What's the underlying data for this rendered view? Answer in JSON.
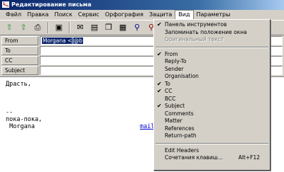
{
  "window": {
    "title": "Редактирование письма"
  },
  "menu": [
    "Файл",
    "Правка",
    "Поиск",
    "Сервис",
    "Орфография",
    "Защита",
    "Вид",
    "Параметры"
  ],
  "toolbar": {
    "icons": [
      "send-icon",
      "send-later-icon",
      "print-icon",
      "save-icon",
      "attach-icon",
      "address-book-icon",
      "copy-icon",
      "paste-icon",
      "find-icon",
      "find-next-icon",
      "spell-icon"
    ]
  },
  "headers": [
    {
      "label": "From",
      "value_prefix": "Morgana <",
      "value_hidden": "                ",
      "value_at": "@b",
      "value_suffix": "                  "
    },
    {
      "label": "To",
      "value": ""
    },
    {
      "label": "CC",
      "value": ""
    },
    {
      "label": "Subject",
      "value": ""
    }
  ],
  "body": {
    "lines": [
      "Драсть,",
      "",
      "",
      "",
      "--",
      "пока-пока,",
      " Morgana"
    ],
    "link_text": "mail"
  },
  "view_menu": {
    "items_top": [
      {
        "label": "Панель инструментов",
        "checked": true,
        "disabled": false
      },
      {
        "label": "Запоминать положение окна",
        "checked": false,
        "disabled": false
      },
      {
        "label": "Оригинальный текст",
        "checked": false,
        "disabled": true
      }
    ],
    "items_headers": [
      {
        "label": "From",
        "checked": true
      },
      {
        "label": "Reply-To",
        "checked": false
      },
      {
        "label": "Sender",
        "checked": false
      },
      {
        "label": "Organisation",
        "checked": false
      },
      {
        "label": "To",
        "checked": true
      },
      {
        "label": "CC",
        "checked": true
      },
      {
        "label": "BCC",
        "checked": false
      },
      {
        "label": "Subject",
        "checked": true
      },
      {
        "label": "Comments",
        "checked": false
      },
      {
        "label": "Matter",
        "checked": false
      },
      {
        "label": "References",
        "checked": false
      },
      {
        "label": "Return-path",
        "checked": false
      }
    ],
    "items_bottom": [
      {
        "label": "Edit Headers",
        "shortcut": ""
      },
      {
        "label": "Сочетания клавиш...",
        "shortcut": "Alt+F12"
      }
    ],
    "check_glyph": "✔"
  }
}
